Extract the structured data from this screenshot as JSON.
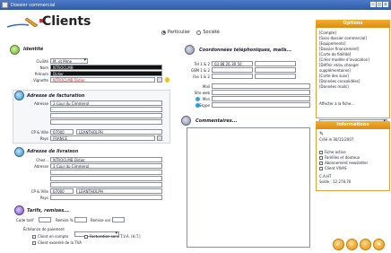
{
  "window": {
    "title": "Dossier commercial"
  },
  "header": {
    "title": "Clients"
  },
  "client_type": {
    "options": [
      "Particulier",
      "Société"
    ],
    "selected": 0
  },
  "identite": {
    "title": "Identité",
    "civilite_label": "Civilité",
    "civilite_value": "M. et Mme",
    "nom_label": "Nom",
    "nom_value": "NTROCLMB",
    "prenom_label": "Prénom",
    "prenom_value": "Didier",
    "vignette_label": "Vignette",
    "vignette_value": "NTROCLMB Didier"
  },
  "facturation": {
    "title": "Adresse de facturation",
    "adresse_label": "Adresse",
    "adresse_value": "3 Cour du Cimmerol",
    "cp_label": "CP & Ville",
    "cp_value": "67000",
    "ville_value": "LEANTHOLPH",
    "pays_label": "Pays",
    "pays_value": "FRANCE"
  },
  "livraison": {
    "title": "Adresse de livraison",
    "chez_label": "Chez...",
    "chez_value": "NTROCLMB Didier",
    "adresse_label": "Adresse",
    "adresse_value": "3 Cour du Cimmerol",
    "cp_label": "CP & Ville",
    "cp_value": "67000",
    "ville_value": "LEANTHOLPH",
    "pays_label": "Pays"
  },
  "tarifs": {
    "title": "Tarifs, remises...",
    "code_label": "Code tarif",
    "remise_pct_label": "Remise %",
    "remise_val_label": "Remise val",
    "echeance_label": "Échéance de paiement",
    "cb1": "Client en compte",
    "cb2": "Facturation sans T.V.A. (H.T.)",
    "cb3": "Client exonéré de la TVA"
  },
  "coordonnees": {
    "title": "Coordonnées téléphoniques, mails...",
    "tel_label": "Tel 1 & 2",
    "tel_value": "03 88 26 39 50",
    "gsm_label": "GSM 1 & 2",
    "fax_label": "Fax 1 & 2",
    "mail_label": "Mail",
    "web_label": "Site web",
    "msn_label": "Msn",
    "skype_label": "Skype"
  },
  "commentaires": {
    "title": "Commentaires..."
  },
  "options": {
    "title": "Options",
    "items": [
      "[Compte]",
      "[Sans dossier commercial]",
      "[Equipements]",
      "[Dossier financement]",
      "[Carte de fidélité]",
      "[Créer modèle d'invocation]",
      "[Définir et/ou changer supplémentaires]",
      "[Carte des suivi]",
      "[Données consolidées]",
      "[Données mails]"
    ],
    "affecter_label": "Affecter à la fiche..."
  },
  "informations": {
    "title": "Informations",
    "created": "Créé le 30/11/2007",
    "checks": [
      "Fiche active",
      "Familles et douteux",
      "Abonnement newsletter",
      "Client VIVAS"
    ],
    "ca_label": "C.A.HT",
    "solde_label": "Solde : 12 278.76"
  }
}
